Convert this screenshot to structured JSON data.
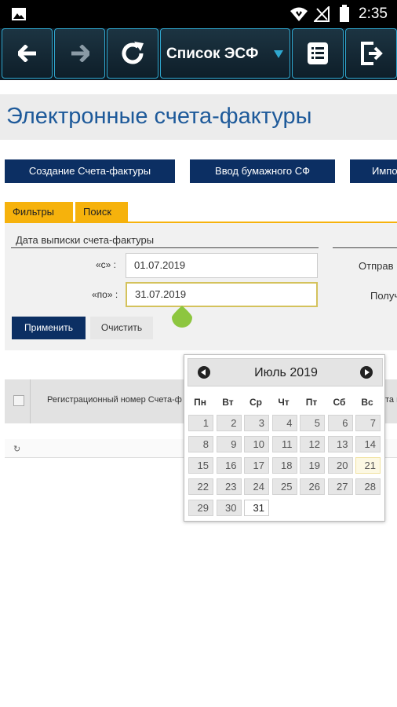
{
  "status_bar": {
    "time": "2:35"
  },
  "toolbar": {
    "select_label": "Список ЭСФ"
  },
  "page": {
    "title": "Электронные счета-фактуры"
  },
  "actions": {
    "create": "Создание Счета-фактуры",
    "paper": "Ввод бумажного СФ",
    "import": "Импо"
  },
  "tabs": {
    "filters": "Фильтры",
    "search": "Поиск"
  },
  "filter": {
    "legend": "Дата выписки счета-фактуры",
    "from_label": "«с» :",
    "from_value": "01.07.2019",
    "to_label": "«по» :",
    "to_value": "31.07.2019",
    "sender_label": "Отправ",
    "receiver_label": "Получ",
    "apply": "Применить",
    "clear": "Очистить"
  },
  "table": {
    "col_reg": "Регистрационный номер Счета-ф",
    "col_right": "та в",
    "refresh": "↻"
  },
  "datepicker": {
    "title": "Июль 2019",
    "weekdays": [
      "Пн",
      "Вт",
      "Ср",
      "Чт",
      "Пт",
      "Сб",
      "Вс"
    ],
    "weeks": [
      [
        "1",
        "2",
        "3",
        "4",
        "5",
        "6",
        "7"
      ],
      [
        "8",
        "9",
        "10",
        "11",
        "12",
        "13",
        "14"
      ],
      [
        "15",
        "16",
        "17",
        "18",
        "19",
        "20",
        "21"
      ],
      [
        "22",
        "23",
        "24",
        "25",
        "26",
        "27",
        "28"
      ],
      [
        "29",
        "30",
        "31",
        "",
        "",
        "",
        ""
      ]
    ],
    "today": "21",
    "selected": "31"
  }
}
